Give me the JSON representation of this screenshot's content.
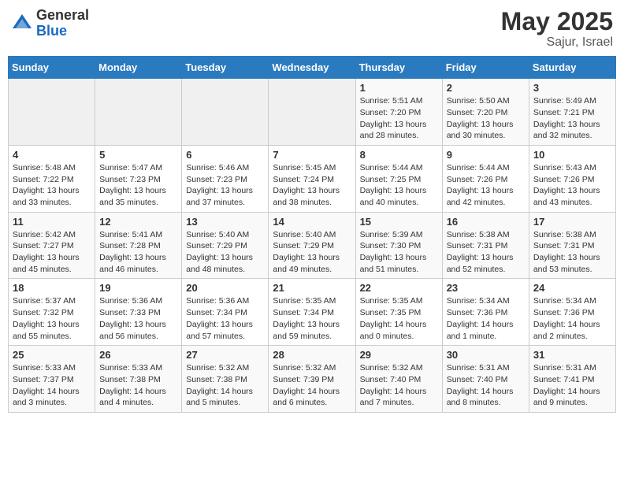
{
  "header": {
    "logo_general": "General",
    "logo_blue": "Blue",
    "month_year": "May 2025",
    "location": "Sajur, Israel"
  },
  "days_of_week": [
    "Sunday",
    "Monday",
    "Tuesday",
    "Wednesday",
    "Thursday",
    "Friday",
    "Saturday"
  ],
  "weeks": [
    [
      {
        "day": "",
        "info": ""
      },
      {
        "day": "",
        "info": ""
      },
      {
        "day": "",
        "info": ""
      },
      {
        "day": "",
        "info": ""
      },
      {
        "day": "1",
        "info": "Sunrise: 5:51 AM\nSunset: 7:20 PM\nDaylight: 13 hours\nand 28 minutes."
      },
      {
        "day": "2",
        "info": "Sunrise: 5:50 AM\nSunset: 7:20 PM\nDaylight: 13 hours\nand 30 minutes."
      },
      {
        "day": "3",
        "info": "Sunrise: 5:49 AM\nSunset: 7:21 PM\nDaylight: 13 hours\nand 32 minutes."
      }
    ],
    [
      {
        "day": "4",
        "info": "Sunrise: 5:48 AM\nSunset: 7:22 PM\nDaylight: 13 hours\nand 33 minutes."
      },
      {
        "day": "5",
        "info": "Sunrise: 5:47 AM\nSunset: 7:23 PM\nDaylight: 13 hours\nand 35 minutes."
      },
      {
        "day": "6",
        "info": "Sunrise: 5:46 AM\nSunset: 7:23 PM\nDaylight: 13 hours\nand 37 minutes."
      },
      {
        "day": "7",
        "info": "Sunrise: 5:45 AM\nSunset: 7:24 PM\nDaylight: 13 hours\nand 38 minutes."
      },
      {
        "day": "8",
        "info": "Sunrise: 5:44 AM\nSunset: 7:25 PM\nDaylight: 13 hours\nand 40 minutes."
      },
      {
        "day": "9",
        "info": "Sunrise: 5:44 AM\nSunset: 7:26 PM\nDaylight: 13 hours\nand 42 minutes."
      },
      {
        "day": "10",
        "info": "Sunrise: 5:43 AM\nSunset: 7:26 PM\nDaylight: 13 hours\nand 43 minutes."
      }
    ],
    [
      {
        "day": "11",
        "info": "Sunrise: 5:42 AM\nSunset: 7:27 PM\nDaylight: 13 hours\nand 45 minutes."
      },
      {
        "day": "12",
        "info": "Sunrise: 5:41 AM\nSunset: 7:28 PM\nDaylight: 13 hours\nand 46 minutes."
      },
      {
        "day": "13",
        "info": "Sunrise: 5:40 AM\nSunset: 7:29 PM\nDaylight: 13 hours\nand 48 minutes."
      },
      {
        "day": "14",
        "info": "Sunrise: 5:40 AM\nSunset: 7:29 PM\nDaylight: 13 hours\nand 49 minutes."
      },
      {
        "day": "15",
        "info": "Sunrise: 5:39 AM\nSunset: 7:30 PM\nDaylight: 13 hours\nand 51 minutes."
      },
      {
        "day": "16",
        "info": "Sunrise: 5:38 AM\nSunset: 7:31 PM\nDaylight: 13 hours\nand 52 minutes."
      },
      {
        "day": "17",
        "info": "Sunrise: 5:38 AM\nSunset: 7:31 PM\nDaylight: 13 hours\nand 53 minutes."
      }
    ],
    [
      {
        "day": "18",
        "info": "Sunrise: 5:37 AM\nSunset: 7:32 PM\nDaylight: 13 hours\nand 55 minutes."
      },
      {
        "day": "19",
        "info": "Sunrise: 5:36 AM\nSunset: 7:33 PM\nDaylight: 13 hours\nand 56 minutes."
      },
      {
        "day": "20",
        "info": "Sunrise: 5:36 AM\nSunset: 7:34 PM\nDaylight: 13 hours\nand 57 minutes."
      },
      {
        "day": "21",
        "info": "Sunrise: 5:35 AM\nSunset: 7:34 PM\nDaylight: 13 hours\nand 59 minutes."
      },
      {
        "day": "22",
        "info": "Sunrise: 5:35 AM\nSunset: 7:35 PM\nDaylight: 14 hours\nand 0 minutes."
      },
      {
        "day": "23",
        "info": "Sunrise: 5:34 AM\nSunset: 7:36 PM\nDaylight: 14 hours\nand 1 minute."
      },
      {
        "day": "24",
        "info": "Sunrise: 5:34 AM\nSunset: 7:36 PM\nDaylight: 14 hours\nand 2 minutes."
      }
    ],
    [
      {
        "day": "25",
        "info": "Sunrise: 5:33 AM\nSunset: 7:37 PM\nDaylight: 14 hours\nand 3 minutes."
      },
      {
        "day": "26",
        "info": "Sunrise: 5:33 AM\nSunset: 7:38 PM\nDaylight: 14 hours\nand 4 minutes."
      },
      {
        "day": "27",
        "info": "Sunrise: 5:32 AM\nSunset: 7:38 PM\nDaylight: 14 hours\nand 5 minutes."
      },
      {
        "day": "28",
        "info": "Sunrise: 5:32 AM\nSunset: 7:39 PM\nDaylight: 14 hours\nand 6 minutes."
      },
      {
        "day": "29",
        "info": "Sunrise: 5:32 AM\nSunset: 7:40 PM\nDaylight: 14 hours\nand 7 minutes."
      },
      {
        "day": "30",
        "info": "Sunrise: 5:31 AM\nSunset: 7:40 PM\nDaylight: 14 hours\nand 8 minutes."
      },
      {
        "day": "31",
        "info": "Sunrise: 5:31 AM\nSunset: 7:41 PM\nDaylight: 14 hours\nand 9 minutes."
      }
    ]
  ]
}
